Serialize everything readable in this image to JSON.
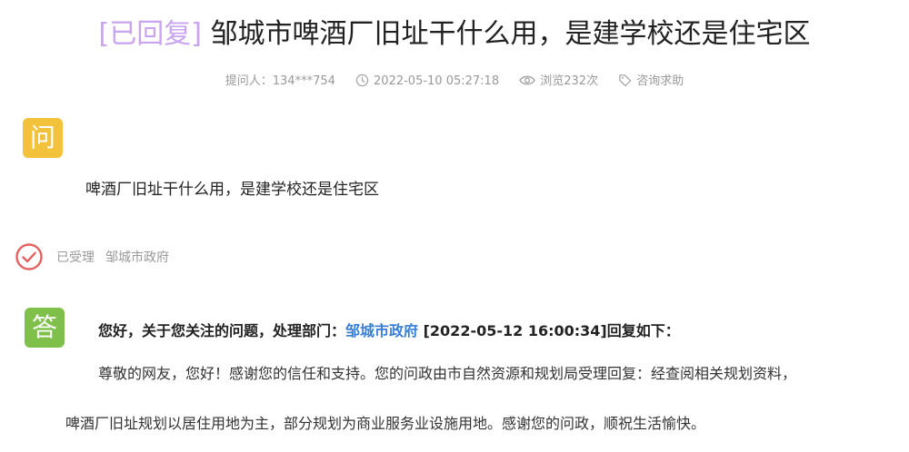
{
  "title": {
    "status": "[已回复]",
    "text": "邹城市啤酒厂旧址干什么用，是建学校还是住宅区"
  },
  "meta": {
    "asker": "提问人：134***754",
    "time": "2022-05-10 05:27:18",
    "views": "浏览232次",
    "category": "咨询求助"
  },
  "question": {
    "badge": "问",
    "text": "啤酒厂旧址干什么用，是建学校还是住宅区"
  },
  "accepted": {
    "status": "已受理",
    "department": "邹城市政府"
  },
  "answer": {
    "badge": "答",
    "head_prefix": "您好，关于您关注的问题，处理部门：",
    "head_department": "邹城市政府",
    "head_suffix": " [2022-05-12 16:00:34]回复如下：",
    "line1": "尊敬的网友，您好！感谢您的信任和支持。您的问政由市自然资源和规划局受理回复：经查阅相关规划资料，",
    "line2": "啤酒厂旧址规划以居住用地为主，部分规划为商业服务业设施用地。感谢您的问政，顺祝生活愉快。"
  },
  "colors": {
    "status_purple": "#c9a4f0",
    "question_badge": "#f2c23a",
    "answer_badge": "#7ec04a",
    "link_blue": "#3a7fd5",
    "check_red": "#e5605f"
  },
  "icons": [
    "clock-icon",
    "eye-icon",
    "tag-icon",
    "check-circle-icon"
  ]
}
